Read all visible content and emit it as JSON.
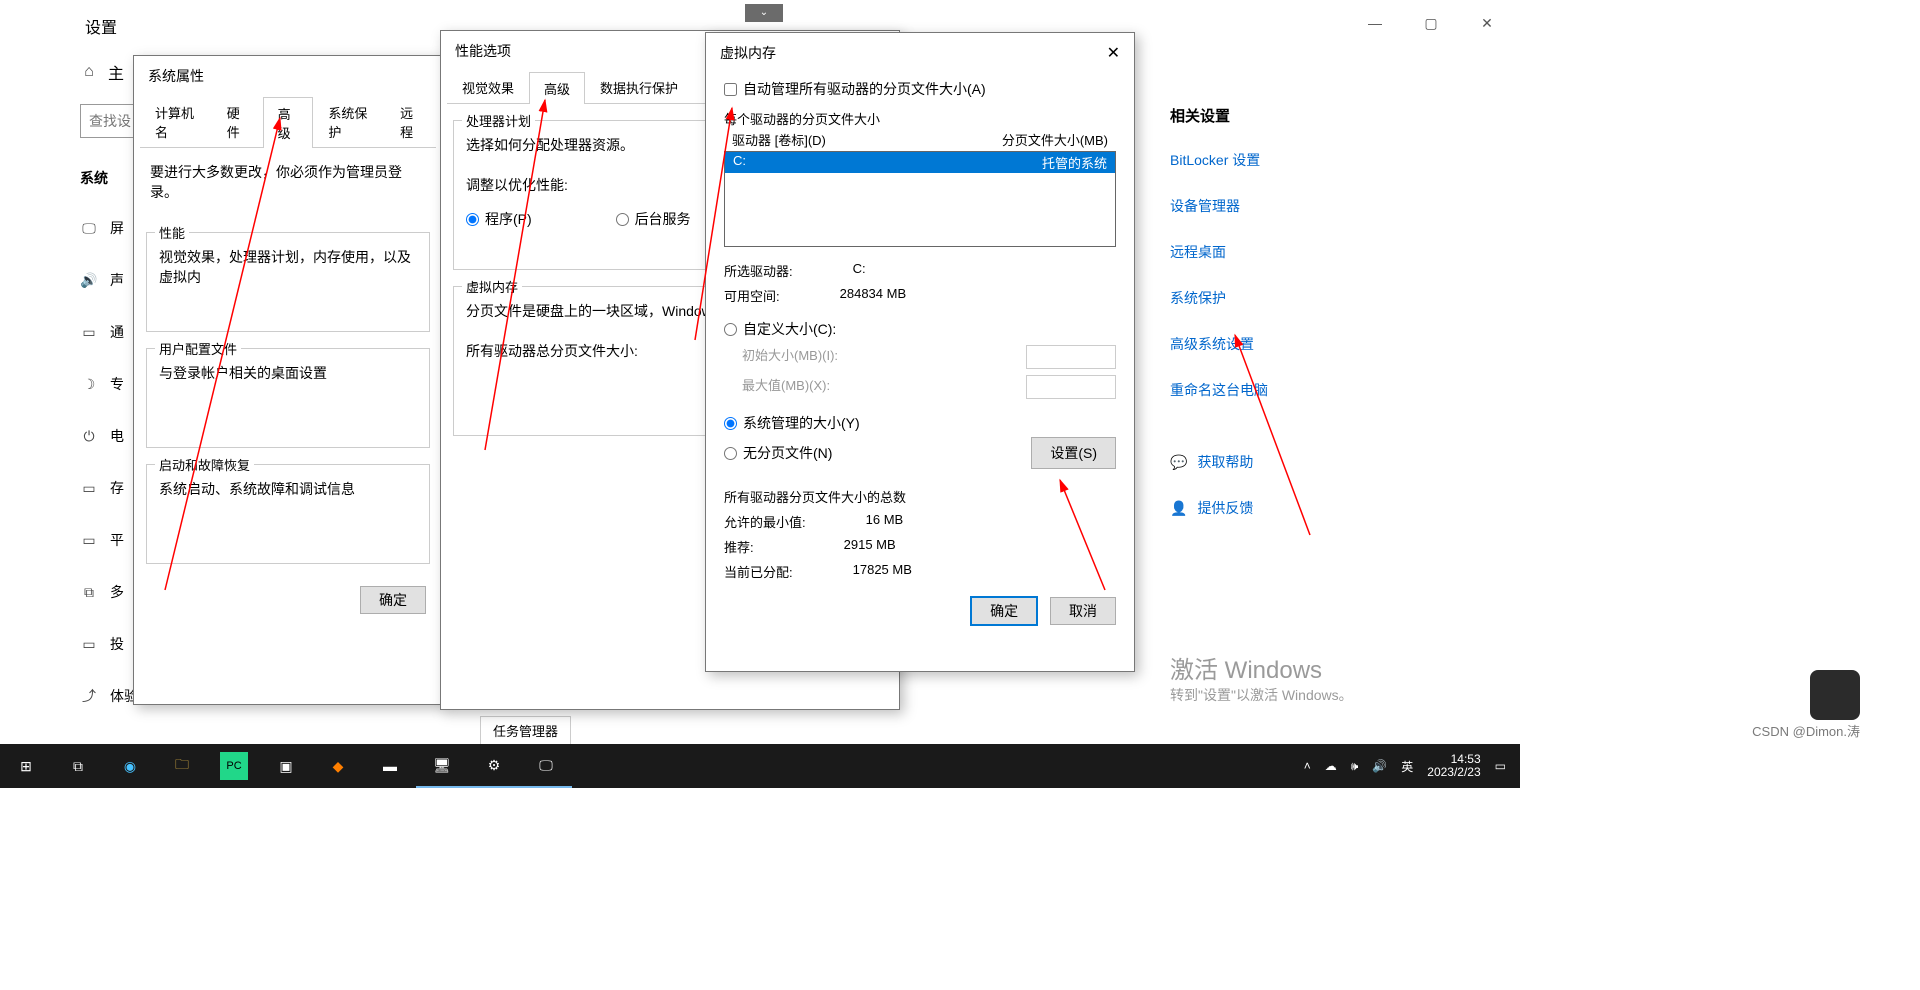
{
  "settings": {
    "title": "设置",
    "home": "主",
    "search_placeholder": "查找设",
    "section": "系统",
    "nav_items": [
      "屏",
      "声",
      "通",
      "专",
      "电",
      "存",
      "平",
      "多",
      "投",
      "体验共享"
    ],
    "win_min": "—",
    "win_max": "▢",
    "win_close": "✕",
    "dropdown_glyph": "⌄"
  },
  "right": {
    "heading": "相关设置",
    "links": {
      "bitlocker": "BitLocker 设置",
      "device_mgr": "设备管理器",
      "remote_desktop": "远程桌面",
      "system_protection": "系统保护",
      "advanced_system": "高级系统设置",
      "rename_pc": "重命名这台电脑",
      "get_help": "获取帮助",
      "feedback": "提供反馈"
    }
  },
  "activate": {
    "big": "激活 Windows",
    "small": "转到\"设置\"以激活 Windows。"
  },
  "watermark": "CSDN @Dimon.涛",
  "task_chip": "任务管理器",
  "sysprops": {
    "title": "系统属性",
    "tabs": {
      "computer": "计算机名",
      "hardware": "硬件",
      "advanced": "高级",
      "protection": "系统保护",
      "remote": "远程"
    },
    "admin_note": "要进行大多数更改，你必须作为管理员登录。",
    "perf": {
      "title": "性能",
      "desc": "视觉效果，处理器计划，内存使用，以及虚拟内"
    },
    "profile": {
      "title": "用户配置文件",
      "desc": "与登录帐户相关的桌面设置"
    },
    "startup": {
      "title": "启动和故障恢复",
      "desc": "系统启动、系统故障和调试信息"
    },
    "ok": "确定"
  },
  "perfopts": {
    "title": "性能选项",
    "tabs": {
      "visual": "视觉效果",
      "advanced": "高级",
      "dep": "数据执行保护"
    },
    "cpu_plan": {
      "title": "处理器计划",
      "desc": "选择如何分配处理器资源。",
      "adjust": "调整以优化性能:",
      "programs": "程序(P)",
      "services": "后台服务"
    },
    "vm": {
      "title": "虚拟内存",
      "desc": "分页文件是硬盘上的一块区域，Window",
      "total": "所有驱动器总分页文件大小:"
    }
  },
  "vmem": {
    "title": "虚拟内存",
    "close_glyph": "✕",
    "auto_chk": "自动管理所有驱动器的分页文件大小(A)",
    "each_drive": "每个驱动器的分页文件大小",
    "drive_header": "驱动器 [卷标](D)",
    "size_header": "分页文件大小(MB)",
    "drive": "C:",
    "drive_status": "托管的系统",
    "selected_drive_label": "所选驱动器:",
    "selected_drive_value": "C:",
    "free_space_label": "可用空间:",
    "free_space_value": "284834 MB",
    "custom": "自定义大小(C):",
    "initial": "初始大小(MB)(I):",
    "max": "最大值(MB)(X):",
    "system_managed": "系统管理的大小(Y)",
    "no_paging": "无分页文件(N)",
    "set_btn": "设置(S)",
    "totals_heading": "所有驱动器分页文件大小的总数",
    "min_label": "允许的最小值:",
    "min_value": "16 MB",
    "rec_label": "推荐:",
    "rec_value": "2915 MB",
    "cur_label": "当前已分配:",
    "cur_value": "17825 MB",
    "ok": "确定",
    "cancel": "取消"
  },
  "taskbar": {
    "time": "14:53",
    "date": "2023/2/23",
    "ime": "英",
    "tray_glyphs": {
      "chevron": "˄",
      "cloud": "☁",
      "wifi": "🕪",
      "vol": "🔊"
    }
  }
}
